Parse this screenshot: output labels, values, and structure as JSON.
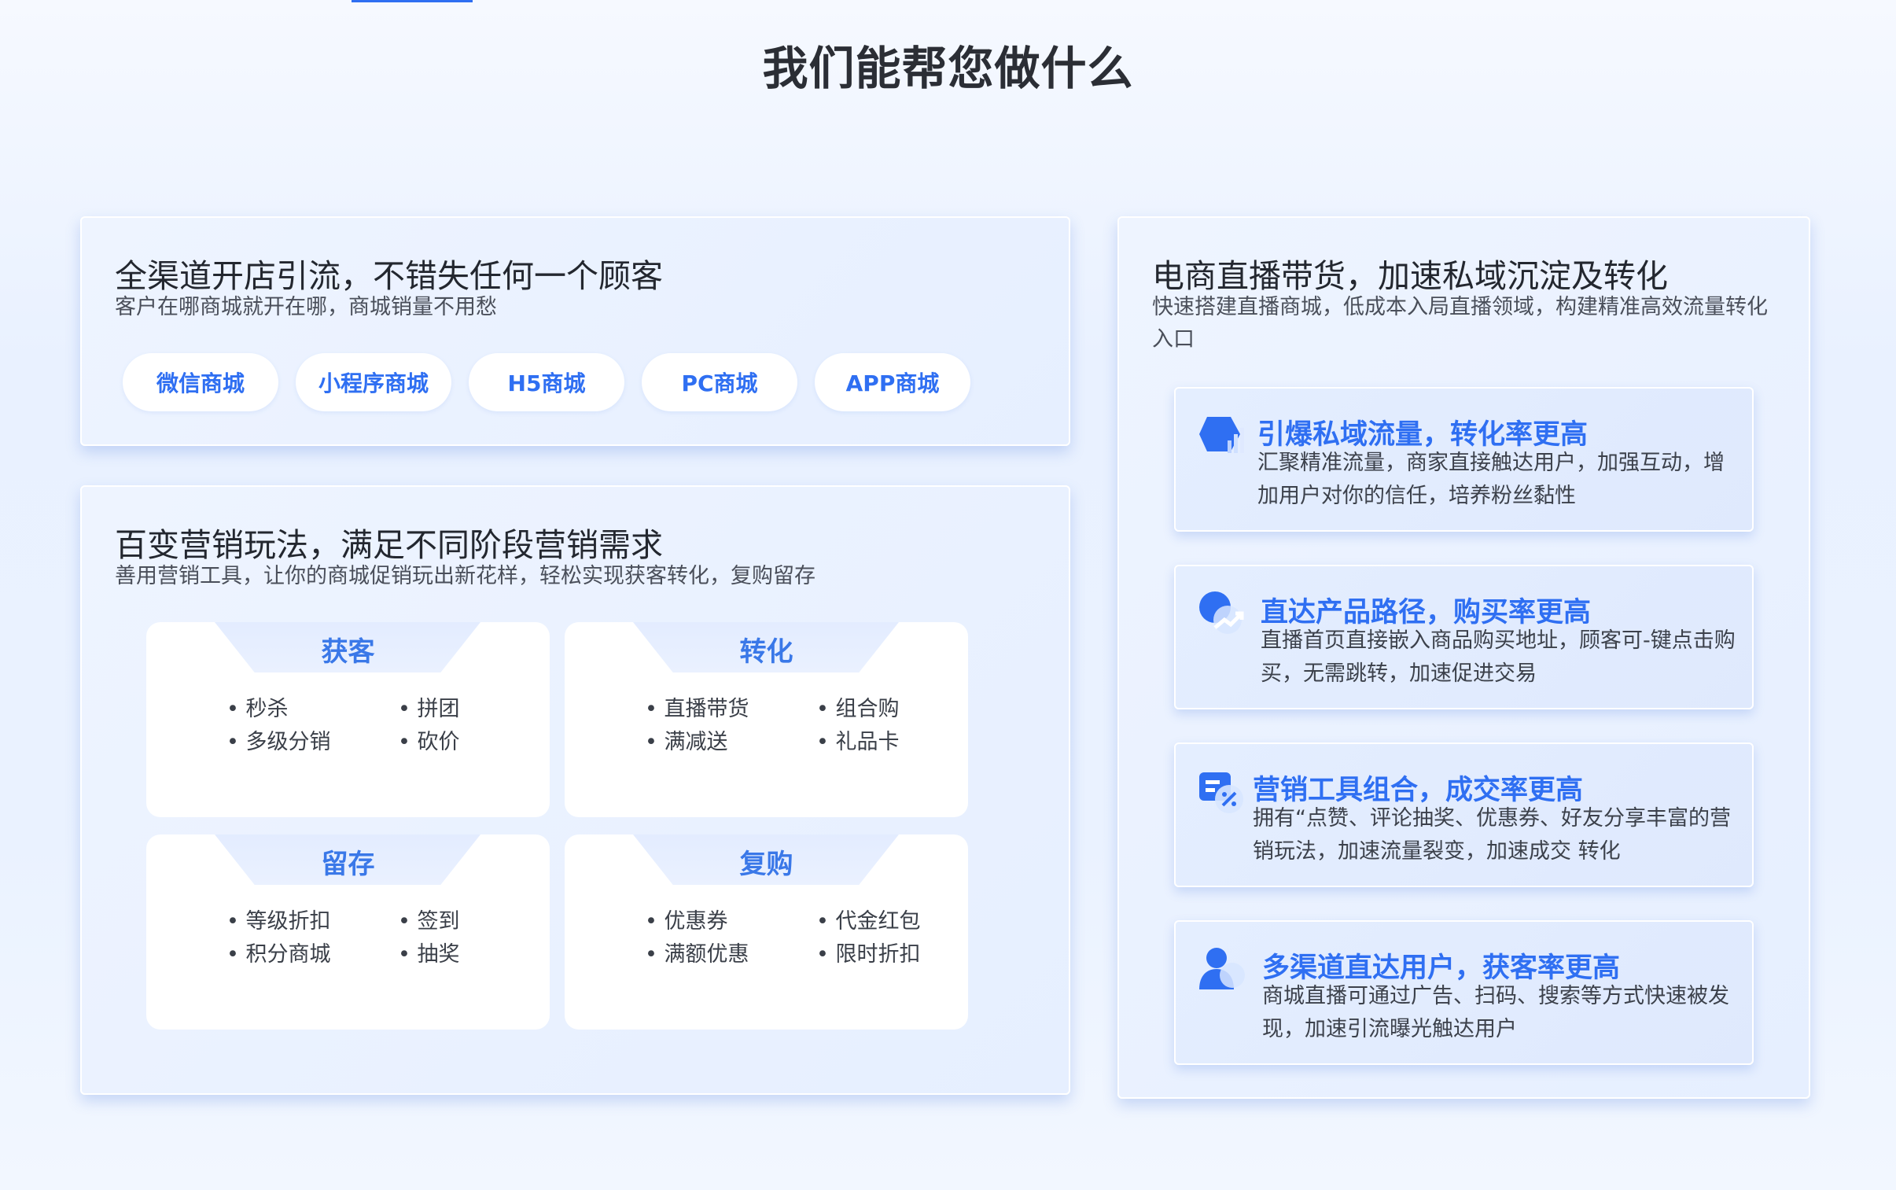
{
  "page_title": "我们能帮您做什么",
  "channels_card": {
    "title": "全渠道开店引流，不错失任何一个顾客",
    "subtitle": "客户在哪商城就开在哪，商城销量不用愁",
    "pills": [
      "微信商城",
      "小程序商城",
      "H5商城",
      "PC商城",
      "APP商城"
    ]
  },
  "marketing_card": {
    "title": "百变营销玩法，满足不同阶段营销需求",
    "subtitle": "善用营销工具，让你的商城促销玩出新花样，轻松实现获客转化，复购留存",
    "tiles": [
      {
        "label": "获客",
        "items": [
          "秒杀",
          "拼团",
          "多级分销",
          "砍价"
        ]
      },
      {
        "label": "转化",
        "items": [
          "直播带货",
          "组合购",
          "满减送",
          "礼品卡"
        ]
      },
      {
        "label": "留存",
        "items": [
          "等级折扣",
          "签到",
          "积分商城",
          "抽奖"
        ]
      },
      {
        "label": "复购",
        "items": [
          "优惠券",
          "代金红包",
          "满额优惠",
          "限时折扣"
        ]
      }
    ]
  },
  "live_card": {
    "title": "电商直播带货，加速私域沉淀及转化",
    "subtitle": "快速搭建直播商城，低成本入局直播领域，构建精准高效流量转化入口",
    "features": [
      {
        "icon": "traffic-chart-icon",
        "title": "引爆私域流量，转化率更高",
        "desc": "汇聚精准流量，商家直接触达用户，加强互动，增加用户对你的信任，培养粉丝黏性"
      },
      {
        "icon": "trend-up-icon",
        "title": "直达产品路径，购买率更高",
        "desc": "直播首页直接嵌入商品购买地址，顾客可-键点击购买，无需跳转，加速促进交易"
      },
      {
        "icon": "discount-ticket-icon",
        "title": "营销工具组合，成交率更高",
        "desc": "拥有“点赞、评论抽奖、优惠券、好友分享丰富的营销玩法，加速流量裂变，加速成交 转化"
      },
      {
        "icon": "user-icon",
        "title": "多渠道直达用户，获客率更高",
        "desc": "商城直播可通过广告、扫码、搜索等方式快速被发现，加速引流曝光触达用户"
      }
    ]
  },
  "colors": {
    "accent": "#2f6ff2",
    "tile_label": "#3a78e8"
  }
}
